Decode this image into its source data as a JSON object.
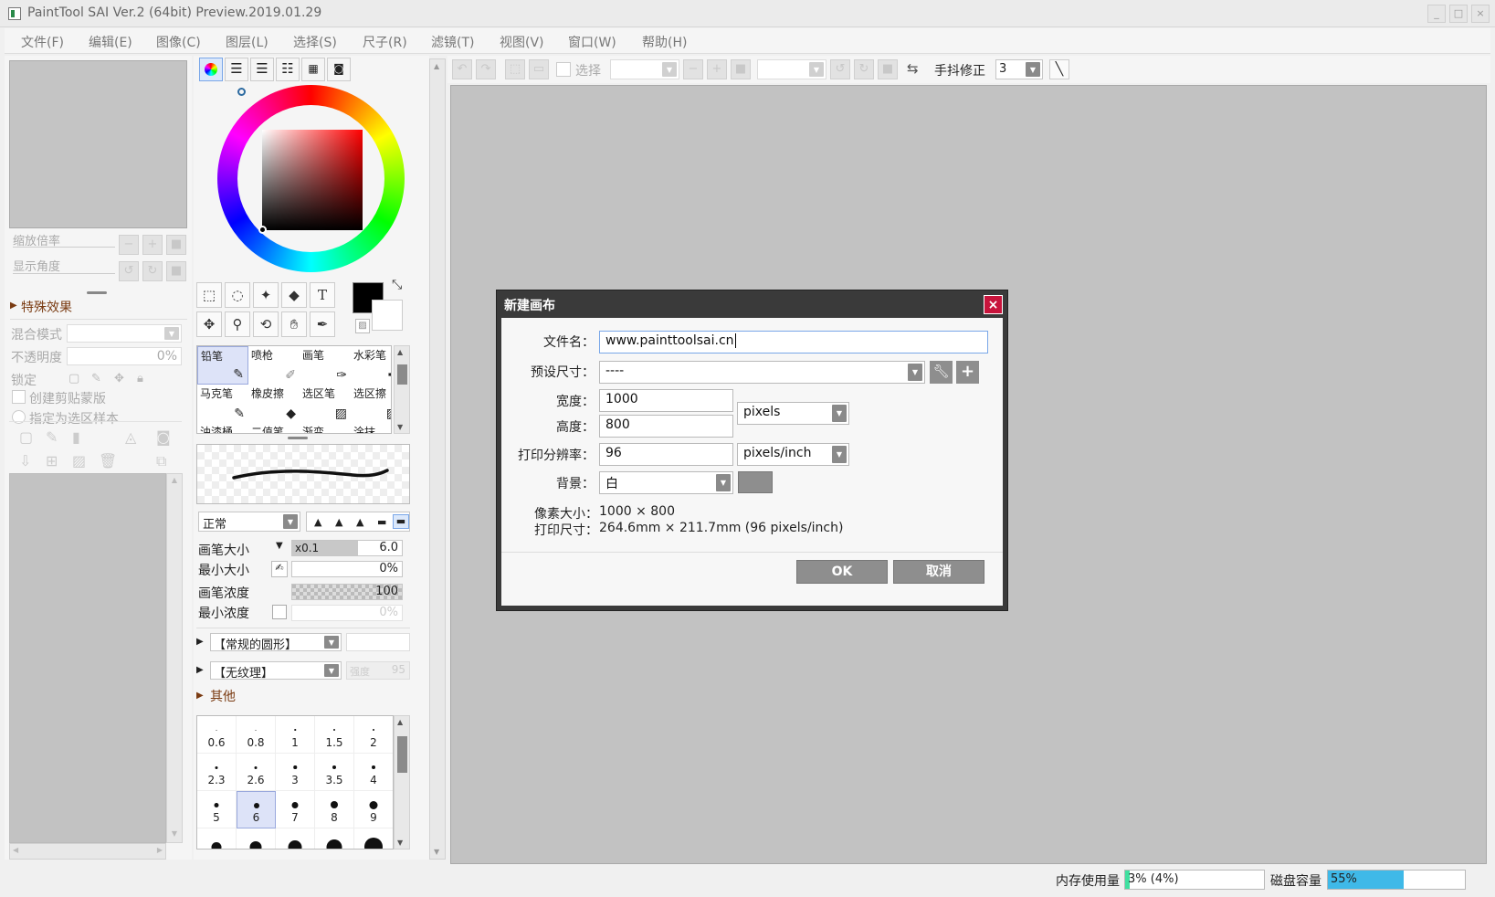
{
  "window": {
    "title": "PaintTool SAI Ver.2 (64bit) Preview.2019.01.29",
    "min": "_",
    "max": "□",
    "close": "×"
  },
  "menu": [
    "文件(F)",
    "编辑(E)",
    "图像(C)",
    "图层(L)",
    "选择(S)",
    "尺子(R)",
    "滤镜(T)",
    "视图(V)",
    "窗口(W)",
    "帮助(H)"
  ],
  "navigator": {
    "zoom_label": "缩放倍率",
    "angle_label": "显示角度"
  },
  "layer_panel": {
    "effects_label": "特殊效果",
    "blend_label": "混合模式",
    "opacity_label": "不透明度",
    "opacity_value": "0%",
    "lock_label": "锁定",
    "clip_label": "创建剪贴蒙版",
    "sample_label": "指定为选区样本"
  },
  "toolbar": {
    "select_label": "选择",
    "stabilizer_label": "手抖修正",
    "stabilizer_value": "3"
  },
  "tools": {
    "text": "T"
  },
  "brushes": [
    {
      "name": "铅笔"
    },
    {
      "name": "喷枪"
    },
    {
      "name": "画笔"
    },
    {
      "name": "水彩笔"
    },
    {
      "name": "马克笔"
    },
    {
      "name": "橡皮擦"
    },
    {
      "name": "选区笔"
    },
    {
      "name": "选区擦"
    },
    {
      "name": "油漆桶"
    },
    {
      "name": "二值笔"
    },
    {
      "name": "渐变"
    },
    {
      "name": "涂抹"
    }
  ],
  "brush_settings": {
    "mode_value": "正常",
    "size_label": "画笔大小",
    "size_multiplier": "x0.1",
    "size_value": "6.0",
    "min_size_label": "最小大小",
    "min_size_value": "0%",
    "density_label": "画笔浓度",
    "density_value": "100",
    "min_density_label": "最小浓度",
    "min_density_value": "0%",
    "shape_value": "【常规的圆形】",
    "texture_value": "【无纹理】",
    "strength_label": "强度",
    "strength_value": "95",
    "other_label": "其他"
  },
  "size_presets": [
    {
      "label": "0.6",
      "d": 1
    },
    {
      "label": "0.8",
      "d": 1
    },
    {
      "label": "1",
      "d": 1.5
    },
    {
      "label": "1.5",
      "d": 2
    },
    {
      "label": "2",
      "d": 2
    },
    {
      "label": "2.3",
      "d": 3
    },
    {
      "label": "2.6",
      "d": 3
    },
    {
      "label": "3",
      "d": 3.5
    },
    {
      "label": "3.5",
      "d": 4
    },
    {
      "label": "4",
      "d": 4
    },
    {
      "label": "5",
      "d": 5
    },
    {
      "label": "6",
      "d": 6
    },
    {
      "label": "7",
      "d": 7
    },
    {
      "label": "8",
      "d": 8
    },
    {
      "label": "9",
      "d": 9
    },
    {
      "label": "",
      "d": 11
    },
    {
      "label": "",
      "d": 13
    },
    {
      "label": "",
      "d": 15
    },
    {
      "label": "",
      "d": 17
    },
    {
      "label": "",
      "d": 20
    }
  ],
  "dialog": {
    "title": "新建画布",
    "filename_label": "文件名：",
    "filename_value": "www.painttoolsai.cn",
    "preset_label": "预设尺寸：",
    "preset_value": "----",
    "width_label": "宽度：",
    "width_value": "1000",
    "height_label": "高度：",
    "height_value": "800",
    "unit_value": "pixels",
    "dpi_label": "打印分辨率：",
    "dpi_value": "96",
    "dpi_unit": "pixels/inch",
    "bg_label": "背景：",
    "bg_value": "白",
    "pixel_size_label": "像素大小：",
    "pixel_size_value": "1000 × 800",
    "print_size_label": "打印尺寸：",
    "print_size_value": "264.6mm × 211.7mm (96 pixels/inch)",
    "ok": "OK",
    "cancel": "取消"
  },
  "status": {
    "memory_label": "内存使用量",
    "memory_value": "3% (4%)",
    "memory_percent": 3,
    "disk_label": "磁盘容量",
    "disk_value": "55%",
    "disk_percent": 55
  },
  "colors": {
    "accent": "#3fb9e8",
    "close_red": "#c8143c",
    "title_dark": "#3a3a3a",
    "current_color": "#000000"
  }
}
